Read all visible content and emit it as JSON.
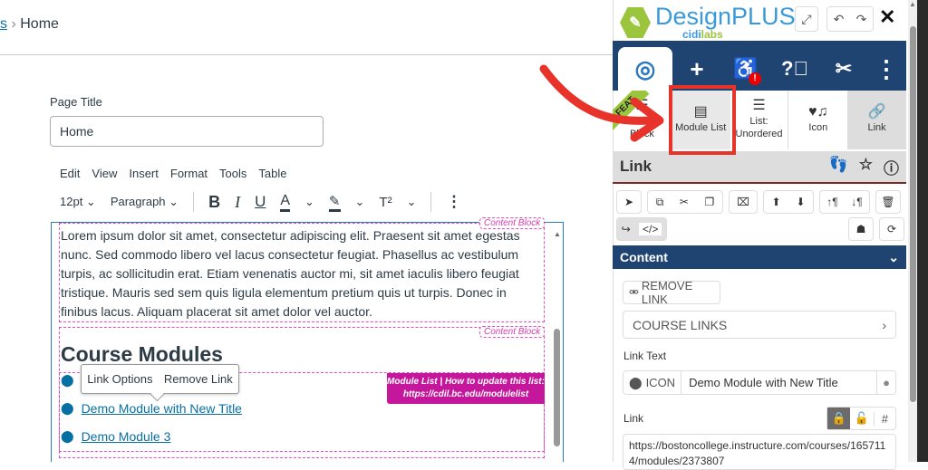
{
  "breadcrumb": {
    "parent": "s",
    "separator": "›",
    "current": "Home"
  },
  "page_title": {
    "label": "Page Title",
    "value": "Home"
  },
  "editor": {
    "menu": [
      "Edit",
      "View",
      "Insert",
      "Format",
      "Tools",
      "Table"
    ],
    "toolbar": {
      "font_size": "12pt",
      "block": "Paragraph",
      "bold": "B",
      "italic": "I",
      "underline": "U",
      "text_color": "A",
      "superscript": "T²",
      "more": "⋮"
    },
    "content_block_tag": "Content Block",
    "paragraph": "Lorem ipsum dolor sit amet, consectetur adipiscing elit. Praesent sit amet egestas nunc. Sed commodo libero vel lacus consectetur feugiat. Phasellus ac vestibulum turpis, ac sollicitudin erat. Etiam venenatis auctor mi, sit amet iaculis libero feugiat tristique. Mauris sed sem quis ligula elementum pretium quis ut turpis. Donec in finibus lacus. Aliquam placerat sit amet dolor vel auctor.",
    "heading": "Course Modules",
    "popup": {
      "options": "Link Options",
      "remove": "Remove Link"
    },
    "module_list_tag": {
      "line1": "Module List | How to update this list:",
      "line2": "https://cdil.bc.edu/modulelist"
    },
    "modules": [
      "Demo Module with New Title",
      "Demo Module 3"
    ]
  },
  "panel": {
    "logo": {
      "name": "DesignPLUS",
      "sub_a": "cidi",
      "sub_b": "labs"
    },
    "nav_icons": [
      "target-icon",
      "plus-icon",
      "accessibility-icon",
      "help-icon",
      "tools-icon",
      "more-icon"
    ],
    "feat_badge": "FEAT",
    "ribbon": [
      {
        "label": "Content Block"
      },
      {
        "label": "Module List"
      },
      {
        "label": "List: Unordered"
      },
      {
        "label": "Icon"
      },
      {
        "label": "Link"
      }
    ],
    "section_title": "Link",
    "content_header": "Content",
    "remove_link": "REMOVE LINK",
    "course_links": "COURSE LINKS",
    "link_text_label": "Link Text",
    "icon_label": "ICON",
    "link_text_value": "Demo Module with New Title",
    "link_label": "Link",
    "link_value": "https://bostoncollege.instructure.com/courses/1657114/modules/2373807"
  },
  "colors": {
    "accent": "#1f4472",
    "link": "#0770a3",
    "annotation": "#e8332a",
    "module_tag": "#c5179c"
  }
}
